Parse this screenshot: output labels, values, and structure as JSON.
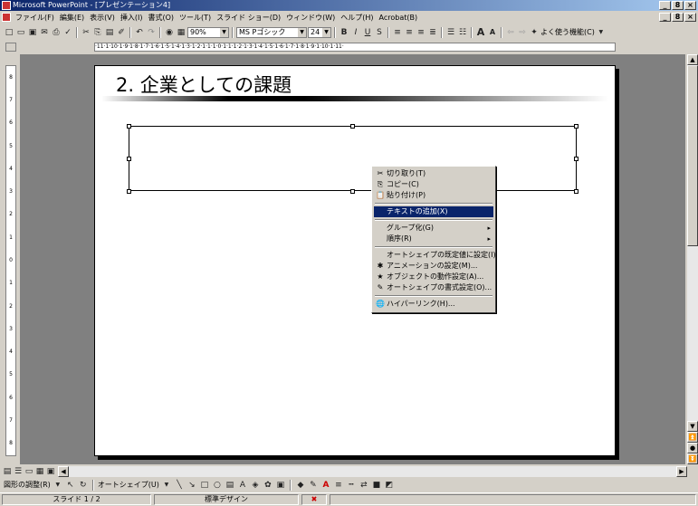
{
  "window": {
    "title": "Microsoft PowerPoint - [プレゼンテーション4]",
    "min": "_",
    "restore": "8",
    "close": "×"
  },
  "menu": [
    "ファイル(F)",
    "編集(E)",
    "表示(V)",
    "挿入(I)",
    "書式(O)",
    "ツール(T)",
    "スライド ショー(D)",
    "ウィンドウ(W)",
    "ヘルプ(H)",
    "Acrobat(B)"
  ],
  "toolbar": {
    "zoom": "90%",
    "font": "MS Pゴシック",
    "size": "24",
    "bold": "B",
    "italic": "I",
    "underline": "U",
    "shadow": "S",
    "grow": "A",
    "shrink": "A",
    "more": "よく使う機能(C)"
  },
  "ruler": {
    "h": "·11·1·10·1·9·1·8·1·7·1·6·1·5·1·4·1·3·1·2·1·1·1·0·1·1·1·2·1·3·1·4·1·5·1·6·1·7·1·8·1·9·1·10·1·11·",
    "v": [
      "8",
      "7",
      "6",
      "5",
      "4",
      "3",
      "2",
      "1",
      "0",
      "1",
      "2",
      "3",
      "4",
      "5",
      "6",
      "7",
      "8"
    ]
  },
  "slide": {
    "title": "2. 企業としての課題"
  },
  "context_menu": [
    {
      "label": "切り取り(T)",
      "icon": "✂"
    },
    {
      "label": "コピー(C)",
      "icon": "⎘"
    },
    {
      "label": "貼り付け(P)",
      "icon": "📋"
    },
    {
      "label": "テキストの追加(X)",
      "icon": ""
    },
    {
      "label": "グループ化(G)",
      "icon": "",
      "sub": "▸"
    },
    {
      "label": "順序(R)",
      "icon": "",
      "sub": "▸"
    },
    {
      "label": "オートシェイプの既定値に設定(I)",
      "icon": ""
    },
    {
      "label": "アニメーションの設定(M)...",
      "icon": "✱"
    },
    {
      "label": "オブジェクトの動作設定(A)...",
      "icon": "★"
    },
    {
      "label": "オートシェイプの書式設定(O)...",
      "icon": "✎"
    },
    {
      "label": "ハイパーリンク(H)...",
      "icon": "🌐"
    }
  ],
  "drawbar": {
    "draw": "図形の調整(R)",
    "autoshape": "オートシェイプ(U)"
  },
  "status": {
    "slide": "スライド 1 / 2",
    "design": "標準デザイン"
  }
}
